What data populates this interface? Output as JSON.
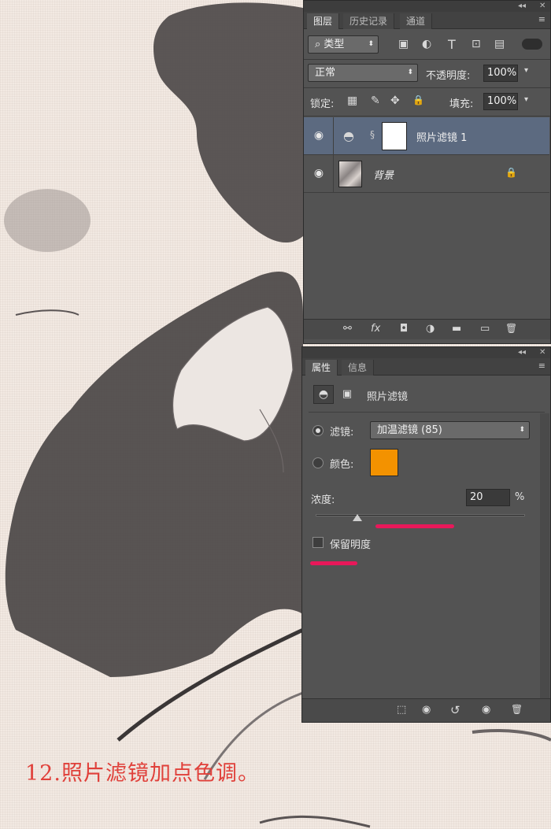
{
  "caption": "12.照片滤镜加点色调。",
  "colors": {
    "panel": "#535353",
    "accent_swatch": "#f39200",
    "annotation": "#e8185a",
    "caption": "#e0403a"
  },
  "layers_panel": {
    "collapse_glyph": "◂◂",
    "close_glyph": "✕",
    "tabs": [
      "图层",
      "历史记录",
      "通道"
    ],
    "menu_glyph": "≡",
    "filter_kind": "类型",
    "filter_search_glyph": "⌕",
    "filter_icons": [
      "image-filter-icon",
      "adjustment-filter-icon",
      "type-filter-icon",
      "shape-filter-icon",
      "smartobject-filter-icon"
    ],
    "filter_glyphs": [
      "▣",
      "◐",
      "T",
      "⊡",
      "▤"
    ],
    "blend_mode": "正常",
    "opacity_label": "不透明度:",
    "opacity_value": "100%",
    "lock_label": "锁定:",
    "fill_label": "填充:",
    "fill_value": "100%",
    "dropdown_arrow": "▾",
    "updown_arrow": "⬍",
    "eye_glyph": "◉",
    "lock_glyphs": [
      "▦",
      "✎",
      "✥",
      "🔒"
    ],
    "layers": [
      {
        "name": "照片滤镜 1",
        "selected": true,
        "icon": "photo-filter-adjustment-icon",
        "glyph": "◓",
        "chain": "§"
      },
      {
        "name": "背景",
        "selected": false,
        "icon": "background-lock-icon",
        "glyph": "🔒"
      }
    ],
    "bottom_icons": [
      "link-layers-icon",
      "fx-icon",
      "add-mask-icon",
      "new-adjustment-icon",
      "new-group-icon",
      "new-layer-icon",
      "delete-layer-icon"
    ],
    "bottom_glyphs": [
      "⚯",
      "fx",
      "◘",
      "◑",
      "▬",
      "▭",
      "🗑"
    ]
  },
  "properties_panel": {
    "collapse_glyph": "◂◂",
    "close_glyph": "✕",
    "tabs": [
      "属性",
      "信息"
    ],
    "menu_glyph": "≡",
    "header_title": "照片滤镜",
    "header_glyphs": [
      "◓",
      "▣"
    ],
    "filter_label": "滤镜:",
    "filter_value": "加温滤镜 (85)",
    "color_label": "颜色:",
    "density_label": "浓度:",
    "density_value": "20",
    "density_unit": "%",
    "density_level": 0.2,
    "preserve_label": "保留明度",
    "bottom_icons": [
      "clip-to-layer-icon",
      "view-previous-icon",
      "reset-icon",
      "visibility-icon",
      "delete-icon"
    ],
    "bottom_glyphs": [
      "⬚",
      "◉",
      "↺",
      "◉",
      "🗑"
    ]
  }
}
